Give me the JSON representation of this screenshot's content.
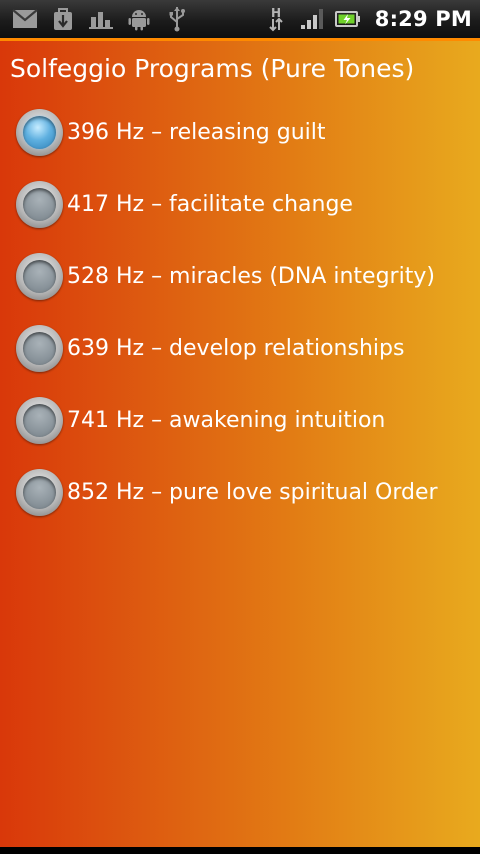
{
  "status_bar": {
    "left_icons": [
      "gmail-icon",
      "download-icon",
      "bar-graph-icon",
      "android-debug-icon",
      "usb-icon"
    ],
    "right_icons": [
      "hspa-network-icon",
      "signal-strength-icon",
      "battery-charging-icon"
    ],
    "network_type": "H",
    "time": "8:29 PM"
  },
  "colors": {
    "accent_line": "#ff8a00",
    "gradient_left": "#d9380a",
    "gradient_right": "#e8aa1e",
    "radio_selected": "#5fb0e0",
    "battery_fill": "#6fd02a"
  },
  "app": {
    "title": "Solfeggio Programs (Pure Tones)",
    "selected_index": 0,
    "programs": [
      {
        "label": "396 Hz – releasing guilt",
        "checked": true
      },
      {
        "label": "417 Hz – facilitate change",
        "checked": false
      },
      {
        "label": "528 Hz – miracles (DNA integrity)",
        "checked": false
      },
      {
        "label": "639 Hz – develop relationships",
        "checked": false
      },
      {
        "label": "741 Hz – awakening intuition",
        "checked": false
      },
      {
        "label": "852 Hz – pure love spiritual Order",
        "checked": false
      }
    ]
  }
}
